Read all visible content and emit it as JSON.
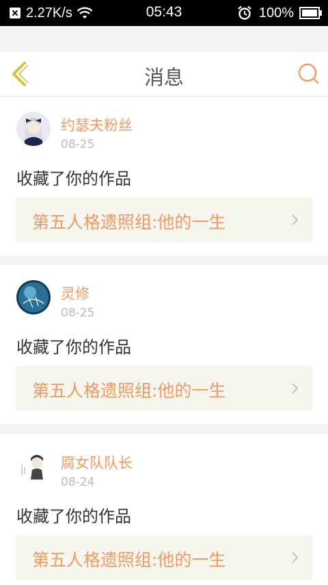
{
  "status_bar": {
    "speed": "2.27K/s",
    "time": "05:43",
    "battery": "100%",
    "battery_level": 1.0,
    "icons": [
      "close-notification-icon",
      "wifi-icon",
      "alarm-icon",
      "battery-icon"
    ]
  },
  "header": {
    "title": "消息",
    "back_icon": "chevron-left-icon",
    "search_icon": "search-icon"
  },
  "colors": {
    "accent": "#ee9a62",
    "back_icon": "#d6c235",
    "background": "#f3f3f3",
    "card": "#ffffff",
    "work_bg": "#f6f5ee"
  },
  "messages": [
    {
      "user": "约瑟夫粉丝",
      "date": "08-25",
      "action": "收藏了你的作品",
      "work": "第五人格遗照组:他的一生"
    },
    {
      "user": "灵修",
      "date": "08-25",
      "action": "收藏了你的作品",
      "work": "第五人格遗照组:他的一生"
    },
    {
      "user": "腐女队队长",
      "date": "08-24",
      "action": "收藏了你的作品",
      "work": "第五人格遗照组:他的一生"
    }
  ]
}
